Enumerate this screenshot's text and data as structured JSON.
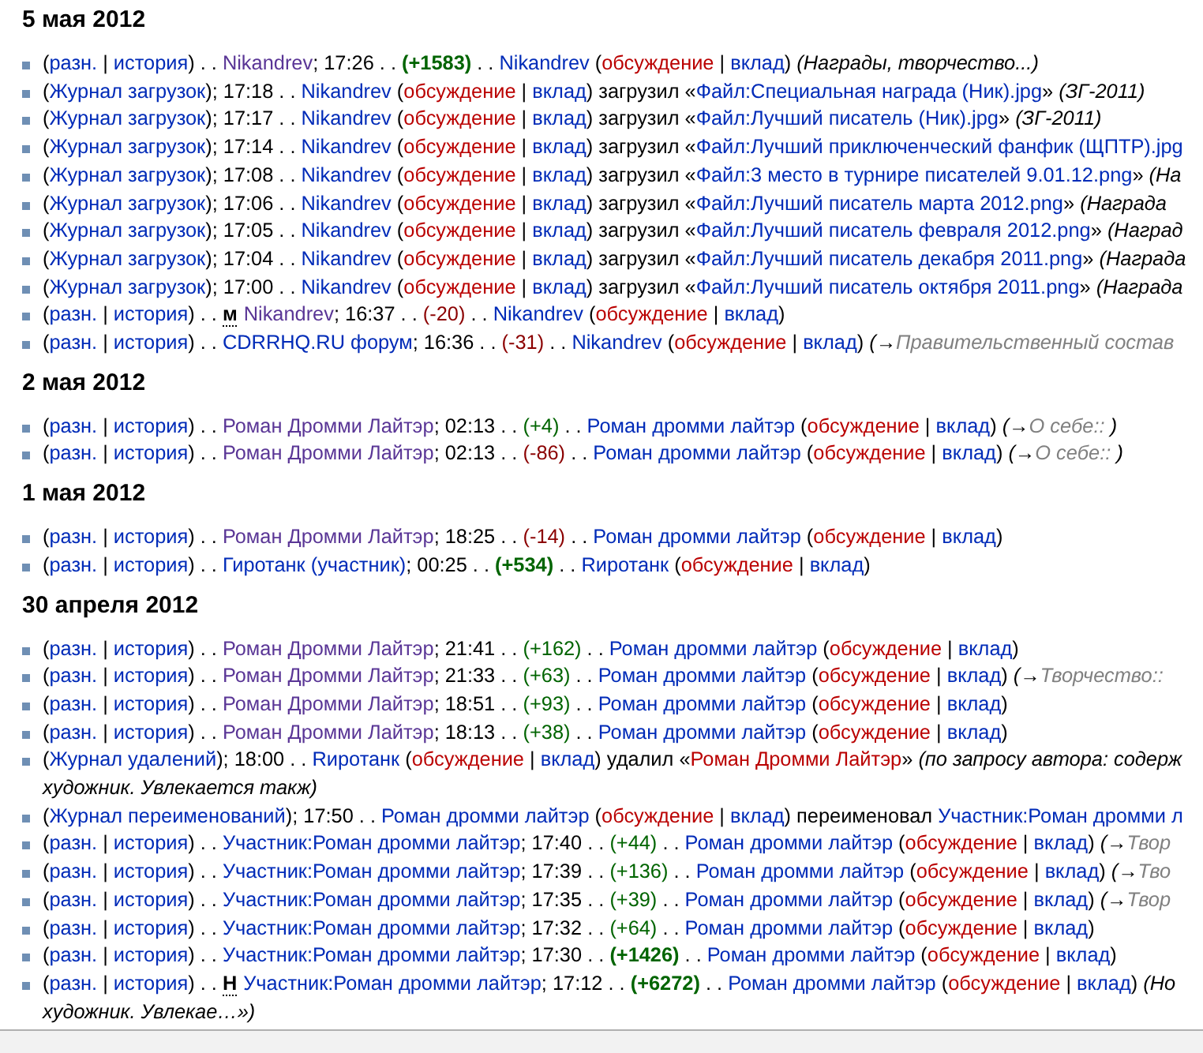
{
  "days": [
    {
      "date": "5 мая 2012",
      "entries": [
        {
          "parts": [
            {
              "kind": "plain",
              "text": "("
            },
            {
              "kind": "link",
              "text": "разн."
            },
            {
              "kind": "plain",
              "text": " | "
            },
            {
              "kind": "link",
              "text": "история"
            },
            {
              "kind": "plain",
              "text": ") . . "
            },
            {
              "kind": "visited",
              "text": "Nikandrev"
            },
            {
              "kind": "plain",
              "text": "; 17:26 . . "
            },
            {
              "kind": "diff_up_large",
              "text": "(+1583)"
            },
            {
              "kind": "plain",
              "text": " . . "
            },
            {
              "kind": "link",
              "text": "Nikandrev"
            },
            {
              "kind": "plain",
              "text": " ("
            },
            {
              "kind": "redlink",
              "text": "обсуждение"
            },
            {
              "kind": "plain",
              "text": " | "
            },
            {
              "kind": "link",
              "text": "вклад"
            },
            {
              "kind": "plain",
              "text": ") "
            },
            {
              "kind": "comment",
              "text": "(Награды, творчество...)"
            }
          ]
        },
        {
          "parts": [
            {
              "kind": "plain",
              "text": "("
            },
            {
              "kind": "link",
              "text": "Журнал загрузок"
            },
            {
              "kind": "plain",
              "text": "); 17:18 . . "
            },
            {
              "kind": "link",
              "text": "Nikandrev"
            },
            {
              "kind": "plain",
              "text": " ("
            },
            {
              "kind": "redlink",
              "text": "обсуждение"
            },
            {
              "kind": "plain",
              "text": " | "
            },
            {
              "kind": "link",
              "text": "вклад"
            },
            {
              "kind": "plain",
              "text": ") загрузил «"
            },
            {
              "kind": "link",
              "text": "Файл:Специальная награда (Ник).jpg"
            },
            {
              "kind": "plain",
              "text": "» "
            },
            {
              "kind": "comment",
              "text": "(ЗГ-2011)"
            }
          ]
        },
        {
          "parts": [
            {
              "kind": "plain",
              "text": "("
            },
            {
              "kind": "link",
              "text": "Журнал загрузок"
            },
            {
              "kind": "plain",
              "text": "); 17:17 . . "
            },
            {
              "kind": "link",
              "text": "Nikandrev"
            },
            {
              "kind": "plain",
              "text": " ("
            },
            {
              "kind": "redlink",
              "text": "обсуждение"
            },
            {
              "kind": "plain",
              "text": " | "
            },
            {
              "kind": "link",
              "text": "вклад"
            },
            {
              "kind": "plain",
              "text": ") загрузил «"
            },
            {
              "kind": "link",
              "text": "Файл:Лучший писатель (Ник).jpg"
            },
            {
              "kind": "plain",
              "text": "» "
            },
            {
              "kind": "comment",
              "text": "(ЗГ-2011)"
            }
          ]
        },
        {
          "parts": [
            {
              "kind": "plain",
              "text": "("
            },
            {
              "kind": "link",
              "text": "Журнал загрузок"
            },
            {
              "kind": "plain",
              "text": "); 17:14 . . "
            },
            {
              "kind": "link",
              "text": "Nikandrev"
            },
            {
              "kind": "plain",
              "text": " ("
            },
            {
              "kind": "redlink",
              "text": "обсуждение"
            },
            {
              "kind": "plain",
              "text": " | "
            },
            {
              "kind": "link",
              "text": "вклад"
            },
            {
              "kind": "plain",
              "text": ") загрузил «"
            },
            {
              "kind": "link",
              "text": "Файл:Лучший приключенческий фанфик (ЩПТР).jpg"
            }
          ]
        },
        {
          "parts": [
            {
              "kind": "plain",
              "text": "("
            },
            {
              "kind": "link",
              "text": "Журнал загрузок"
            },
            {
              "kind": "plain",
              "text": "); 17:08 . . "
            },
            {
              "kind": "link",
              "text": "Nikandrev"
            },
            {
              "kind": "plain",
              "text": " ("
            },
            {
              "kind": "redlink",
              "text": "обсуждение"
            },
            {
              "kind": "plain",
              "text": " | "
            },
            {
              "kind": "link",
              "text": "вклад"
            },
            {
              "kind": "plain",
              "text": ") загрузил «"
            },
            {
              "kind": "link",
              "text": "Файл:3 место в турнире писателей 9.01.12.png"
            },
            {
              "kind": "plain",
              "text": "» "
            },
            {
              "kind": "comment",
              "text": "(На"
            }
          ]
        },
        {
          "parts": [
            {
              "kind": "plain",
              "text": "("
            },
            {
              "kind": "link",
              "text": "Журнал загрузок"
            },
            {
              "kind": "plain",
              "text": "); 17:06 . . "
            },
            {
              "kind": "link",
              "text": "Nikandrev"
            },
            {
              "kind": "plain",
              "text": " ("
            },
            {
              "kind": "redlink",
              "text": "обсуждение"
            },
            {
              "kind": "plain",
              "text": " | "
            },
            {
              "kind": "link",
              "text": "вклад"
            },
            {
              "kind": "plain",
              "text": ") загрузил «"
            },
            {
              "kind": "link",
              "text": "Файл:Лучший писатель марта 2012.png"
            },
            {
              "kind": "plain",
              "text": "» "
            },
            {
              "kind": "comment",
              "text": "(Награда"
            }
          ]
        },
        {
          "parts": [
            {
              "kind": "plain",
              "text": "("
            },
            {
              "kind": "link",
              "text": "Журнал загрузок"
            },
            {
              "kind": "plain",
              "text": "); 17:05 . . "
            },
            {
              "kind": "link",
              "text": "Nikandrev"
            },
            {
              "kind": "plain",
              "text": " ("
            },
            {
              "kind": "redlink",
              "text": "обсуждение"
            },
            {
              "kind": "plain",
              "text": " | "
            },
            {
              "kind": "link",
              "text": "вклад"
            },
            {
              "kind": "plain",
              "text": ") загрузил «"
            },
            {
              "kind": "link",
              "text": "Файл:Лучший писатель февраля 2012.png"
            },
            {
              "kind": "plain",
              "text": "» "
            },
            {
              "kind": "comment",
              "text": "(Наград"
            }
          ]
        },
        {
          "parts": [
            {
              "kind": "plain",
              "text": "("
            },
            {
              "kind": "link",
              "text": "Журнал загрузок"
            },
            {
              "kind": "plain",
              "text": "); 17:04 . . "
            },
            {
              "kind": "link",
              "text": "Nikandrev"
            },
            {
              "kind": "plain",
              "text": " ("
            },
            {
              "kind": "redlink",
              "text": "обсуждение"
            },
            {
              "kind": "plain",
              "text": " | "
            },
            {
              "kind": "link",
              "text": "вклад"
            },
            {
              "kind": "plain",
              "text": ") загрузил «"
            },
            {
              "kind": "link",
              "text": "Файл:Лучший писатель декабря 2011.png"
            },
            {
              "kind": "plain",
              "text": "» "
            },
            {
              "kind": "comment",
              "text": "(Награда"
            }
          ]
        },
        {
          "parts": [
            {
              "kind": "plain",
              "text": "("
            },
            {
              "kind": "link",
              "text": "Журнал загрузок"
            },
            {
              "kind": "plain",
              "text": "); 17:00 . . "
            },
            {
              "kind": "link",
              "text": "Nikandrev"
            },
            {
              "kind": "plain",
              "text": " ("
            },
            {
              "kind": "redlink",
              "text": "обсуждение"
            },
            {
              "kind": "plain",
              "text": " | "
            },
            {
              "kind": "link",
              "text": "вклад"
            },
            {
              "kind": "plain",
              "text": ") загрузил «"
            },
            {
              "kind": "link",
              "text": "Файл:Лучший писатель октября 2011.png"
            },
            {
              "kind": "plain",
              "text": "» "
            },
            {
              "kind": "comment",
              "text": "(Награда"
            }
          ]
        },
        {
          "parts": [
            {
              "kind": "plain",
              "text": "("
            },
            {
              "kind": "link",
              "text": "разн."
            },
            {
              "kind": "plain",
              "text": " | "
            },
            {
              "kind": "link",
              "text": "история"
            },
            {
              "kind": "plain",
              "text": ") . . "
            },
            {
              "kind": "flag",
              "text": "м"
            },
            {
              "kind": "visited",
              "text": "Nikandrev"
            },
            {
              "kind": "plain",
              "text": "; 16:37 . . "
            },
            {
              "kind": "diff_down",
              "text": "(-20)"
            },
            {
              "kind": "plain",
              "text": " . . "
            },
            {
              "kind": "link",
              "text": "Nikandrev"
            },
            {
              "kind": "plain",
              "text": " ("
            },
            {
              "kind": "redlink",
              "text": "обсуждение"
            },
            {
              "kind": "plain",
              "text": " | "
            },
            {
              "kind": "link",
              "text": "вклад"
            },
            {
              "kind": "plain",
              "text": ")"
            }
          ]
        },
        {
          "parts": [
            {
              "kind": "plain",
              "text": "("
            },
            {
              "kind": "link",
              "text": "разн."
            },
            {
              "kind": "plain",
              "text": " | "
            },
            {
              "kind": "link",
              "text": "история"
            },
            {
              "kind": "plain",
              "text": ") . . "
            },
            {
              "kind": "link",
              "text": "CDRRHQ.RU форум"
            },
            {
              "kind": "plain",
              "text": "; 16:36 . . "
            },
            {
              "kind": "diff_down",
              "text": "(-31)"
            },
            {
              "kind": "plain",
              "text": " . . "
            },
            {
              "kind": "link",
              "text": "Nikandrev"
            },
            {
              "kind": "plain",
              "text": " ("
            },
            {
              "kind": "redlink",
              "text": "обсуждение"
            },
            {
              "kind": "plain",
              "text": " | "
            },
            {
              "kind": "link",
              "text": "вклад"
            },
            {
              "kind": "plain",
              "text": ") "
            },
            {
              "kind": "comment",
              "text": "(→"
            },
            {
              "kind": "section",
              "text": "Правительственный состав"
            }
          ]
        }
      ]
    },
    {
      "date": "2 мая 2012",
      "entries": [
        {
          "parts": [
            {
              "kind": "plain",
              "text": "("
            },
            {
              "kind": "link",
              "text": "разн."
            },
            {
              "kind": "plain",
              "text": " | "
            },
            {
              "kind": "link",
              "text": "история"
            },
            {
              "kind": "plain",
              "text": ") . . "
            },
            {
              "kind": "visited",
              "text": "Роман Дромми Лайтэр"
            },
            {
              "kind": "plain",
              "text": "; 02:13 . . "
            },
            {
              "kind": "diff_up",
              "text": "(+4)"
            },
            {
              "kind": "plain",
              "text": " . . "
            },
            {
              "kind": "link",
              "text": "Роман дромми лайтэр"
            },
            {
              "kind": "plain",
              "text": " ("
            },
            {
              "kind": "redlink",
              "text": "обсуждение"
            },
            {
              "kind": "plain",
              "text": " | "
            },
            {
              "kind": "link",
              "text": "вклад"
            },
            {
              "kind": "plain",
              "text": ") "
            },
            {
              "kind": "comment",
              "text": "(→"
            },
            {
              "kind": "section",
              "text": "О себе:: "
            },
            {
              "kind": "comment",
              "text": ")"
            }
          ]
        },
        {
          "parts": [
            {
              "kind": "plain",
              "text": "("
            },
            {
              "kind": "link",
              "text": "разн."
            },
            {
              "kind": "plain",
              "text": " | "
            },
            {
              "kind": "link",
              "text": "история"
            },
            {
              "kind": "plain",
              "text": ") . . "
            },
            {
              "kind": "visited",
              "text": "Роман Дромми Лайтэр"
            },
            {
              "kind": "plain",
              "text": "; 02:13 . . "
            },
            {
              "kind": "diff_down",
              "text": "(-86)"
            },
            {
              "kind": "plain",
              "text": " . . "
            },
            {
              "kind": "link",
              "text": "Роман дромми лайтэр"
            },
            {
              "kind": "plain",
              "text": " ("
            },
            {
              "kind": "redlink",
              "text": "обсуждение"
            },
            {
              "kind": "plain",
              "text": " | "
            },
            {
              "kind": "link",
              "text": "вклад"
            },
            {
              "kind": "plain",
              "text": ") "
            },
            {
              "kind": "comment",
              "text": "(→"
            },
            {
              "kind": "section",
              "text": "О себе:: "
            },
            {
              "kind": "comment",
              "text": ")"
            }
          ]
        }
      ]
    },
    {
      "date": "1 мая 2012",
      "entries": [
        {
          "parts": [
            {
              "kind": "plain",
              "text": "("
            },
            {
              "kind": "link",
              "text": "разн."
            },
            {
              "kind": "plain",
              "text": " | "
            },
            {
              "kind": "link",
              "text": "история"
            },
            {
              "kind": "plain",
              "text": ") . . "
            },
            {
              "kind": "visited",
              "text": "Роман Дромми Лайтэр"
            },
            {
              "kind": "plain",
              "text": "; 18:25 . . "
            },
            {
              "kind": "diff_down",
              "text": "(-14)"
            },
            {
              "kind": "plain",
              "text": " . . "
            },
            {
              "kind": "link",
              "text": "Роман дромми лайтэр"
            },
            {
              "kind": "plain",
              "text": " ("
            },
            {
              "kind": "redlink",
              "text": "обсуждение"
            },
            {
              "kind": "plain",
              "text": " | "
            },
            {
              "kind": "link",
              "text": "вклад"
            },
            {
              "kind": "plain",
              "text": ")"
            }
          ]
        },
        {
          "parts": [
            {
              "kind": "plain",
              "text": "("
            },
            {
              "kind": "link",
              "text": "разн."
            },
            {
              "kind": "plain",
              "text": " | "
            },
            {
              "kind": "link",
              "text": "история"
            },
            {
              "kind": "plain",
              "text": ") . . "
            },
            {
              "kind": "link",
              "text": "Гиротанк (участник)"
            },
            {
              "kind": "plain",
              "text": "; 00:25 . . "
            },
            {
              "kind": "diff_up_large",
              "text": "(+534)"
            },
            {
              "kind": "plain",
              "text": " . . "
            },
            {
              "kind": "link",
              "text": "Rиротанк"
            },
            {
              "kind": "plain",
              "text": " ("
            },
            {
              "kind": "redlink",
              "text": "обсуждение"
            },
            {
              "kind": "plain",
              "text": " | "
            },
            {
              "kind": "link",
              "text": "вклад"
            },
            {
              "kind": "plain",
              "text": ")"
            }
          ]
        }
      ]
    },
    {
      "date": "30 апреля 2012",
      "entries": [
        {
          "parts": [
            {
              "kind": "plain",
              "text": "("
            },
            {
              "kind": "link",
              "text": "разн."
            },
            {
              "kind": "plain",
              "text": " | "
            },
            {
              "kind": "link",
              "text": "история"
            },
            {
              "kind": "plain",
              "text": ") . . "
            },
            {
              "kind": "visited",
              "text": "Роман Дромми Лайтэр"
            },
            {
              "kind": "plain",
              "text": "; 21:41 . . "
            },
            {
              "kind": "diff_up",
              "text": "(+162)"
            },
            {
              "kind": "plain",
              "text": " . . "
            },
            {
              "kind": "link",
              "text": "Роман дромми лайтэр"
            },
            {
              "kind": "plain",
              "text": " ("
            },
            {
              "kind": "redlink",
              "text": "обсуждение"
            },
            {
              "kind": "plain",
              "text": " | "
            },
            {
              "kind": "link",
              "text": "вклад"
            },
            {
              "kind": "plain",
              "text": ")"
            }
          ]
        },
        {
          "parts": [
            {
              "kind": "plain",
              "text": "("
            },
            {
              "kind": "link",
              "text": "разн."
            },
            {
              "kind": "plain",
              "text": " | "
            },
            {
              "kind": "link",
              "text": "история"
            },
            {
              "kind": "plain",
              "text": ") . . "
            },
            {
              "kind": "visited",
              "text": "Роман Дромми Лайтэр"
            },
            {
              "kind": "plain",
              "text": "; 21:33 . . "
            },
            {
              "kind": "diff_up",
              "text": "(+63)"
            },
            {
              "kind": "plain",
              "text": " . . "
            },
            {
              "kind": "link",
              "text": "Роман дромми лайтэр"
            },
            {
              "kind": "plain",
              "text": " ("
            },
            {
              "kind": "redlink",
              "text": "обсуждение"
            },
            {
              "kind": "plain",
              "text": " | "
            },
            {
              "kind": "link",
              "text": "вклад"
            },
            {
              "kind": "plain",
              "text": ") "
            },
            {
              "kind": "comment",
              "text": "(→"
            },
            {
              "kind": "section",
              "text": "Творчество::"
            }
          ]
        },
        {
          "parts": [
            {
              "kind": "plain",
              "text": "("
            },
            {
              "kind": "link",
              "text": "разн."
            },
            {
              "kind": "plain",
              "text": " | "
            },
            {
              "kind": "link",
              "text": "история"
            },
            {
              "kind": "plain",
              "text": ") . . "
            },
            {
              "kind": "visited",
              "text": "Роман Дромми Лайтэр"
            },
            {
              "kind": "plain",
              "text": "; 18:51 . . "
            },
            {
              "kind": "diff_up",
              "text": "(+93)"
            },
            {
              "kind": "plain",
              "text": " . . "
            },
            {
              "kind": "link",
              "text": "Роман дромми лайтэр"
            },
            {
              "kind": "plain",
              "text": " ("
            },
            {
              "kind": "redlink",
              "text": "обсуждение"
            },
            {
              "kind": "plain",
              "text": " | "
            },
            {
              "kind": "link",
              "text": "вклад"
            },
            {
              "kind": "plain",
              "text": ")"
            }
          ]
        },
        {
          "parts": [
            {
              "kind": "plain",
              "text": "("
            },
            {
              "kind": "link",
              "text": "разн."
            },
            {
              "kind": "plain",
              "text": " | "
            },
            {
              "kind": "link",
              "text": "история"
            },
            {
              "kind": "plain",
              "text": ") . . "
            },
            {
              "kind": "visited",
              "text": "Роман Дромми Лайтэр"
            },
            {
              "kind": "plain",
              "text": "; 18:13 . . "
            },
            {
              "kind": "diff_up",
              "text": "(+38)"
            },
            {
              "kind": "plain",
              "text": " . . "
            },
            {
              "kind": "link",
              "text": "Роман дромми лайтэр"
            },
            {
              "kind": "plain",
              "text": " ("
            },
            {
              "kind": "redlink",
              "text": "обсуждение"
            },
            {
              "kind": "plain",
              "text": " | "
            },
            {
              "kind": "link",
              "text": "вклад"
            },
            {
              "kind": "plain",
              "text": ")"
            }
          ]
        },
        {
          "parts": [
            {
              "kind": "plain",
              "text": "("
            },
            {
              "kind": "link",
              "text": "Журнал удалений"
            },
            {
              "kind": "plain",
              "text": "); 18:00 . . "
            },
            {
              "kind": "link",
              "text": "Rиротанк"
            },
            {
              "kind": "plain",
              "text": " ("
            },
            {
              "kind": "redlink",
              "text": "обсуждение"
            },
            {
              "kind": "plain",
              "text": " | "
            },
            {
              "kind": "link",
              "text": "вклад"
            },
            {
              "kind": "plain",
              "text": ") удалил «"
            },
            {
              "kind": "redlink",
              "text": "Роман Дромми Лайтэр"
            },
            {
              "kind": "plain",
              "text": "» "
            },
            {
              "kind": "comment",
              "text": "(по запросу автора: содерж"
            }
          ],
          "continuation": "художник. Увлекается такж)"
        },
        {
          "parts": [
            {
              "kind": "plain",
              "text": "("
            },
            {
              "kind": "link",
              "text": "Журнал переименований"
            },
            {
              "kind": "plain",
              "text": "); 17:50 . . "
            },
            {
              "kind": "link",
              "text": "Роман дромми лайтэр"
            },
            {
              "kind": "plain",
              "text": " ("
            },
            {
              "kind": "redlink",
              "text": "обсуждение"
            },
            {
              "kind": "plain",
              "text": " | "
            },
            {
              "kind": "link",
              "text": "вклад"
            },
            {
              "kind": "plain",
              "text": ") переименовал "
            },
            {
              "kind": "link",
              "text": "Участник:Роман дромми л"
            }
          ]
        },
        {
          "parts": [
            {
              "kind": "plain",
              "text": "("
            },
            {
              "kind": "link",
              "text": "разн."
            },
            {
              "kind": "plain",
              "text": " | "
            },
            {
              "kind": "link",
              "text": "история"
            },
            {
              "kind": "plain",
              "text": ") . . "
            },
            {
              "kind": "link",
              "text": "Участник:Роман дромми лайтэр"
            },
            {
              "kind": "plain",
              "text": "; 17:40 . . "
            },
            {
              "kind": "diff_up",
              "text": "(+44)"
            },
            {
              "kind": "plain",
              "text": " . . "
            },
            {
              "kind": "link",
              "text": "Роман дромми лайтэр"
            },
            {
              "kind": "plain",
              "text": " ("
            },
            {
              "kind": "redlink",
              "text": "обсуждение"
            },
            {
              "kind": "plain",
              "text": " | "
            },
            {
              "kind": "link",
              "text": "вклад"
            },
            {
              "kind": "plain",
              "text": ") "
            },
            {
              "kind": "comment",
              "text": "(→"
            },
            {
              "kind": "section",
              "text": "Твор"
            }
          ]
        },
        {
          "parts": [
            {
              "kind": "plain",
              "text": "("
            },
            {
              "kind": "link",
              "text": "разн."
            },
            {
              "kind": "plain",
              "text": " | "
            },
            {
              "kind": "link",
              "text": "история"
            },
            {
              "kind": "plain",
              "text": ") . . "
            },
            {
              "kind": "link",
              "text": "Участник:Роман дромми лайтэр"
            },
            {
              "kind": "plain",
              "text": "; 17:39 . . "
            },
            {
              "kind": "diff_up",
              "text": "(+136)"
            },
            {
              "kind": "plain",
              "text": " . . "
            },
            {
              "kind": "link",
              "text": "Роман дромми лайтэр"
            },
            {
              "kind": "plain",
              "text": " ("
            },
            {
              "kind": "redlink",
              "text": "обсуждение"
            },
            {
              "kind": "plain",
              "text": " | "
            },
            {
              "kind": "link",
              "text": "вклад"
            },
            {
              "kind": "plain",
              "text": ") "
            },
            {
              "kind": "comment",
              "text": "(→"
            },
            {
              "kind": "section",
              "text": "Тво"
            }
          ]
        },
        {
          "parts": [
            {
              "kind": "plain",
              "text": "("
            },
            {
              "kind": "link",
              "text": "разн."
            },
            {
              "kind": "plain",
              "text": " | "
            },
            {
              "kind": "link",
              "text": "история"
            },
            {
              "kind": "plain",
              "text": ") . . "
            },
            {
              "kind": "link",
              "text": "Участник:Роман дромми лайтэр"
            },
            {
              "kind": "plain",
              "text": "; 17:35 . . "
            },
            {
              "kind": "diff_up",
              "text": "(+39)"
            },
            {
              "kind": "plain",
              "text": " . . "
            },
            {
              "kind": "link",
              "text": "Роман дромми лайтэр"
            },
            {
              "kind": "plain",
              "text": " ("
            },
            {
              "kind": "redlink",
              "text": "обсуждение"
            },
            {
              "kind": "plain",
              "text": " | "
            },
            {
              "kind": "link",
              "text": "вклад"
            },
            {
              "kind": "plain",
              "text": ") "
            },
            {
              "kind": "comment",
              "text": "(→"
            },
            {
              "kind": "section",
              "text": "Твор"
            }
          ]
        },
        {
          "parts": [
            {
              "kind": "plain",
              "text": "("
            },
            {
              "kind": "link",
              "text": "разн."
            },
            {
              "kind": "plain",
              "text": " | "
            },
            {
              "kind": "link",
              "text": "история"
            },
            {
              "kind": "plain",
              "text": ") . . "
            },
            {
              "kind": "link",
              "text": "Участник:Роман дромми лайтэр"
            },
            {
              "kind": "plain",
              "text": "; 17:32 . . "
            },
            {
              "kind": "diff_up",
              "text": "(+64)"
            },
            {
              "kind": "plain",
              "text": " . . "
            },
            {
              "kind": "link",
              "text": "Роман дромми лайтэр"
            },
            {
              "kind": "plain",
              "text": " ("
            },
            {
              "kind": "redlink",
              "text": "обсуждение"
            },
            {
              "kind": "plain",
              "text": " | "
            },
            {
              "kind": "link",
              "text": "вклад"
            },
            {
              "kind": "plain",
              "text": ")"
            }
          ]
        },
        {
          "parts": [
            {
              "kind": "plain",
              "text": "("
            },
            {
              "kind": "link",
              "text": "разн."
            },
            {
              "kind": "plain",
              "text": " | "
            },
            {
              "kind": "link",
              "text": "история"
            },
            {
              "kind": "plain",
              "text": ") . . "
            },
            {
              "kind": "link",
              "text": "Участник:Роман дромми лайтэр"
            },
            {
              "kind": "plain",
              "text": "; 17:30 . . "
            },
            {
              "kind": "diff_up_large",
              "text": "(+1426)"
            },
            {
              "kind": "plain",
              "text": " . . "
            },
            {
              "kind": "link",
              "text": "Роман дромми лайтэр"
            },
            {
              "kind": "plain",
              "text": " ("
            },
            {
              "kind": "redlink",
              "text": "обсуждение"
            },
            {
              "kind": "plain",
              "text": " | "
            },
            {
              "kind": "link",
              "text": "вклад"
            },
            {
              "kind": "plain",
              "text": ")"
            }
          ]
        },
        {
          "parts": [
            {
              "kind": "plain",
              "text": "("
            },
            {
              "kind": "link",
              "text": "разн."
            },
            {
              "kind": "plain",
              "text": " | "
            },
            {
              "kind": "link",
              "text": "история"
            },
            {
              "kind": "plain",
              "text": ") . . "
            },
            {
              "kind": "flag",
              "text": "Н"
            },
            {
              "kind": "link",
              "text": "Участник:Роман дромми лайтэр"
            },
            {
              "kind": "plain",
              "text": "; 17:12 . . "
            },
            {
              "kind": "diff_up_large",
              "text": "(+6272)"
            },
            {
              "kind": "plain",
              "text": " . . "
            },
            {
              "kind": "link",
              "text": "Роман дромми лайтэр"
            },
            {
              "kind": "plain",
              "text": " ("
            },
            {
              "kind": "redlink",
              "text": "обсуждение"
            },
            {
              "kind": "plain",
              "text": " | "
            },
            {
              "kind": "link",
              "text": "вклад"
            },
            {
              "kind": "plain",
              "text": ") "
            },
            {
              "kind": "comment",
              "text": "(Но"
            }
          ],
          "continuation": "художник. Увлекае…»)"
        }
      ]
    }
  ]
}
